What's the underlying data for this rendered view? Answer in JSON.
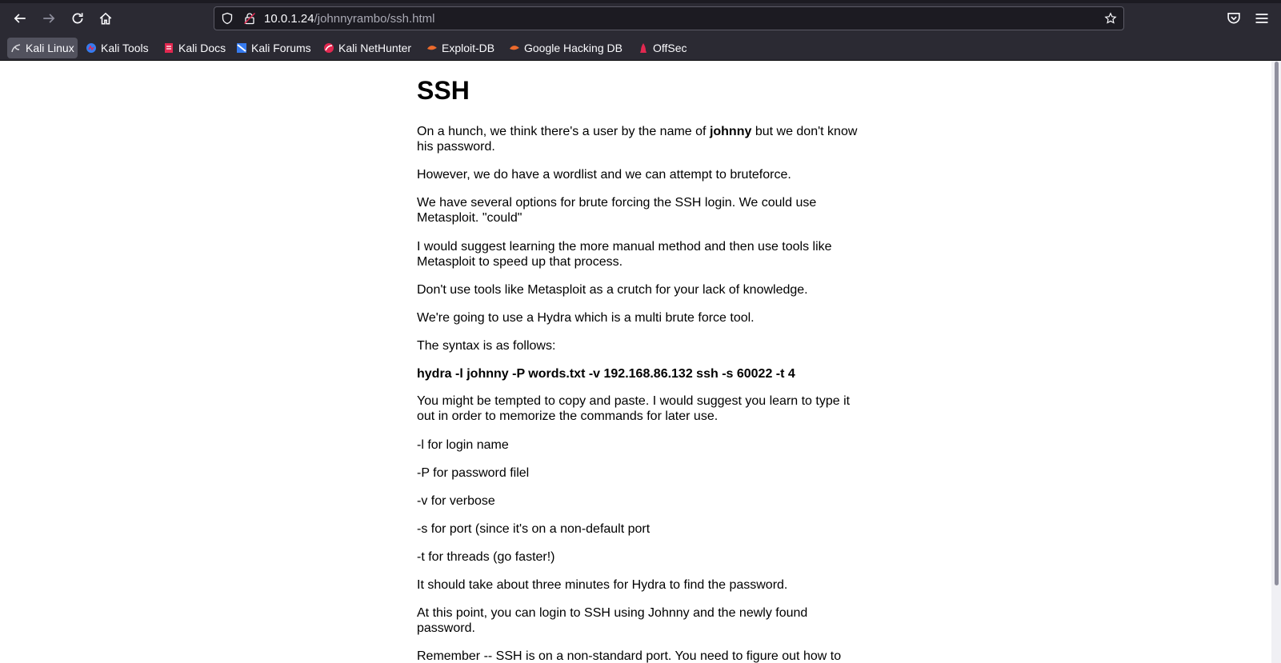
{
  "browser": {
    "url_host": "10.0.1.24",
    "url_path": "/johnnyrambo/ssh.html"
  },
  "bookmarks": [
    {
      "label": "Kali Linux",
      "icon": "kali-dragon-icon"
    },
    {
      "label": "Kali Tools",
      "icon": "kali-tools-icon"
    },
    {
      "label": "Kali Docs",
      "icon": "kali-docs-icon"
    },
    {
      "label": "Kali Forums",
      "icon": "kali-forums-icon"
    },
    {
      "label": "Kali NetHunter",
      "icon": "kali-nethunter-icon"
    },
    {
      "label": "Exploit-DB",
      "icon": "exploit-db-icon"
    },
    {
      "label": "Google Hacking DB",
      "icon": "ghdb-icon"
    },
    {
      "label": "OffSec",
      "icon": "offsec-icon"
    }
  ],
  "colors": {
    "toolbar": "#2b2a33",
    "page_bg": "#ffffff",
    "text": "#000000"
  },
  "page": {
    "title": "SSH",
    "p1_before": "On a hunch, we think there's a user by the name of ",
    "p1_bold": "johnny",
    "p1_after": " but we don't know his password.",
    "p2": "However, we do have a wordlist and we can attempt to bruteforce.",
    "p3": "We have several options for brute forcing the SSH login. We could use Metasploit. \"could\"",
    "p4": "I would suggest learning the more manual method and then use tools like Metasploit to speed up that process.",
    "p5": "Don't use tools like Metasploit as a crutch for your lack of knowledge.",
    "p6": "We're going to use a Hydra which is a multi brute force tool.",
    "p7": "The syntax is as follows:",
    "command": "hydra -l johnny -P words.txt -v 192.168.86.132 ssh -s 60022 -t 4",
    "p8": "You might be tempted to copy and paste. I would suggest you learn to type it out in order to memorize the commands for later use.",
    "flag_l": "-l for login name",
    "flag_P": "-P for password filel",
    "flag_v": "-v for verbose",
    "flag_s": "-s for port (since it's on a non-default port",
    "flag_t": "-t for threads (go faster!)",
    "p9": "It should take about three minutes for Hydra to find the password.",
    "p10": "At this point, you can login to SSH using Johnny and the newly found password.",
    "p11": "Remember -- SSH is on a non-standard port. You need to figure out how to"
  }
}
